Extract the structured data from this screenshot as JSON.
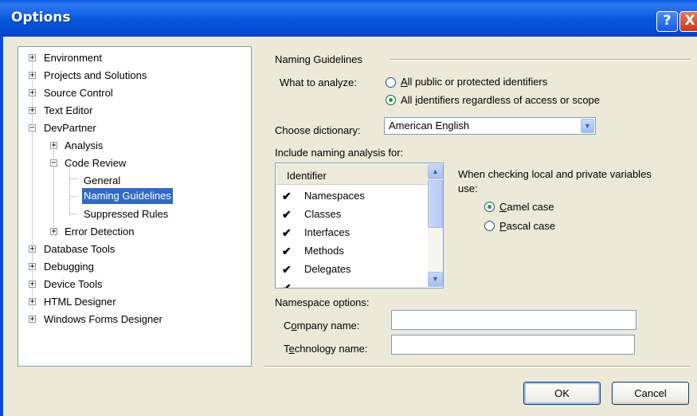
{
  "window": {
    "title": "Options",
    "help_glyph": "?",
    "close_glyph": "X"
  },
  "tree": [
    {
      "label": "Environment",
      "expander": "+"
    },
    {
      "label": "Projects and Solutions",
      "expander": "+"
    },
    {
      "label": "Source Control",
      "expander": "+"
    },
    {
      "label": "Text Editor",
      "expander": "+"
    },
    {
      "label": "DevPartner",
      "expander": "−"
    },
    {
      "label": "Analysis",
      "expander": "+"
    },
    {
      "label": "Code Review",
      "expander": "−"
    },
    {
      "label": "General"
    },
    {
      "label": "Naming Guidelines"
    },
    {
      "label": "Suppressed Rules"
    },
    {
      "label": "Error Detection",
      "expander": "+"
    },
    {
      "label": "Database Tools",
      "expander": "+"
    },
    {
      "label": "Debugging",
      "expander": "+"
    },
    {
      "label": "Device Tools",
      "expander": "+"
    },
    {
      "label": "HTML Designer",
      "expander": "+"
    },
    {
      "label": "Windows Forms Designer",
      "expander": "+"
    }
  ],
  "panel": {
    "section_title": "Naming Guidelines",
    "analyze": {
      "label": "What to analyze:",
      "opt1": "All public or protected identifiers",
      "opt1_access": "A",
      "opt1_rest": "ll public or protected identifiers",
      "opt2": "All identifiers regardless of access or scope",
      "opt2_pre": "All ",
      "opt2_access": "i",
      "opt2_rest": "dentifiers regardless of access or scope",
      "selected": 2
    },
    "dictionary": {
      "label": "Choose dictionary:",
      "value": "American English"
    },
    "include_label": "Include naming analysis for:",
    "list": {
      "header": "Identifier",
      "rows": [
        {
          "label": "Namespaces",
          "checked": true
        },
        {
          "label": "Classes",
          "checked": true
        },
        {
          "label": "Interfaces",
          "checked": true
        },
        {
          "label": "Methods",
          "checked": true
        },
        {
          "label": "Delegates",
          "checked": true
        }
      ]
    },
    "local": {
      "label_line1": "When checking local and private variables",
      "label_line2": "use:",
      "opt1": "Camel case",
      "opt1_access": "C",
      "opt1_rest": "amel case",
      "opt2": "Pascal case",
      "opt2_access": "P",
      "opt2_rest": "ascal case",
      "selected": 1
    },
    "namespace": {
      "label": "Namespace options:",
      "company_label": "Company name:",
      "company_access": "o",
      "company_pre": "C",
      "company_rest": "mpany name:",
      "company_value": "",
      "tech_label": "Technology name:",
      "tech_pre": "T",
      "tech_access": "e",
      "tech_rest": "chnology name:",
      "tech_value": ""
    }
  },
  "buttons": {
    "ok": "OK",
    "cancel": "Cancel"
  },
  "colors": {
    "title_bar": "#0757dd",
    "selection": "#316ac5",
    "radio_dot": "#21a121"
  }
}
